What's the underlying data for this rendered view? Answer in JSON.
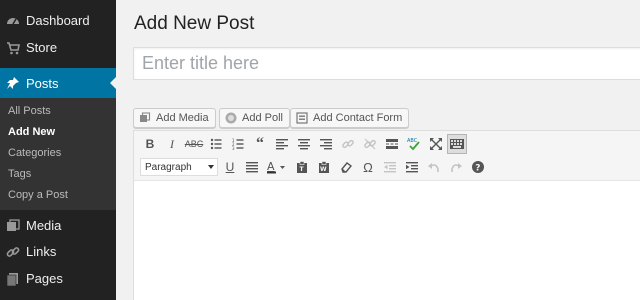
{
  "sidebar": {
    "items": [
      {
        "label": "Dashboard",
        "icon": "dashboard-icon"
      },
      {
        "label": "Store",
        "icon": "cart-icon"
      },
      {
        "label": "Posts",
        "icon": "pin-icon"
      },
      {
        "label": "Media",
        "icon": "media-icon"
      },
      {
        "label": "Links",
        "icon": "links-icon"
      },
      {
        "label": "Pages",
        "icon": "pages-icon"
      }
    ],
    "submenu": [
      "All Posts",
      "Add New",
      "Categories",
      "Tags",
      "Copy a Post"
    ],
    "active_color": "#0074a2",
    "background": "#222222"
  },
  "main": {
    "title": "Add New Post",
    "title_placeholder": "Enter title here",
    "buttons": {
      "add_media": "Add Media",
      "add_poll": "Add Poll",
      "add_contact_form": "Add Contact Form"
    },
    "editor": {
      "format_select": "Paragraph",
      "toolbar_row1": [
        "bold-icon",
        "italic-icon",
        "strikethrough-icon",
        "bullet-list-icon",
        "numbered-list-icon",
        "blockquote-icon",
        "align-left-icon",
        "align-center-icon",
        "align-right-icon",
        "insert-link-icon",
        "unlink-icon",
        "read-more-icon",
        "spellcheck-icon",
        "fullscreen-icon",
        "toolbar-toggle-icon"
      ],
      "toolbar_row2": [
        "underline-icon",
        "justify-icon",
        "text-color-icon",
        "paste-text-icon",
        "paste-word-icon",
        "clear-formatting-icon",
        "special-character-icon",
        "outdent-icon",
        "indent-icon",
        "undo-icon",
        "redo-icon",
        "help-icon"
      ]
    }
  }
}
